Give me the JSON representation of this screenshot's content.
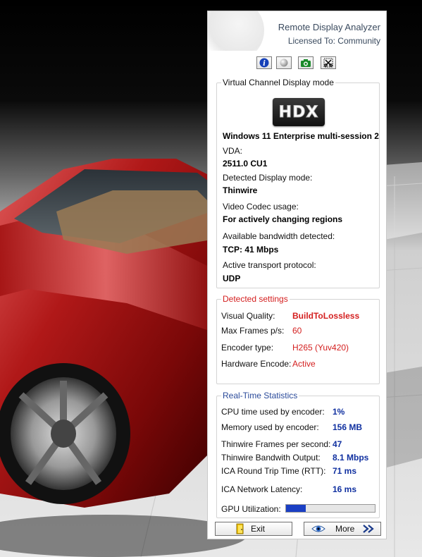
{
  "panel": {
    "title": "Remote Display Analyzer",
    "license": "Licensed To: Community",
    "toolbar": {
      "info_icon": "info-icon",
      "ball_icon": "ball-icon",
      "camera_icon": "camera-icon",
      "snip_icon": "snip-icon"
    },
    "virtual_channel": {
      "group_title": "Virtual Channel Display mode",
      "logo_text": "HDX",
      "os_name": "Windows 11 Enterprise multi-session 2",
      "vda_label": "VDA:",
      "vda_value": "2511.0 CU1",
      "display_mode_label": "Detected Display mode:",
      "display_mode_value": "Thinwire",
      "codec_label": "Video Codec usage:",
      "codec_value": "For actively changing regions",
      "bandwidth_label": "Available bandwidth detected:",
      "bandwidth_value": "TCP: 41 Mbps",
      "transport_label": "Active transport protocol:",
      "transport_value": "UDP"
    },
    "detected": {
      "group_title": "Detected settings",
      "visual_quality_label": "Visual Quality:",
      "visual_quality_value": "BuildToLossless",
      "max_frames_label": "Max Frames p/s:",
      "max_frames_value": "60",
      "encoder_label": "Encoder type:",
      "encoder_value": "H265 (Yuv420)",
      "hw_encode_label": "Hardware Encode:",
      "hw_encode_value": "Active"
    },
    "realtime": {
      "group_title": "Real-Time Statistics",
      "cpu_label": "CPU time used by encoder:",
      "cpu_value": "1%",
      "memory_label": "Memory used by encoder:",
      "memory_value": "156 MB",
      "fps_label": "Thinwire Frames per second:",
      "fps_value": "47",
      "bandwidth_out_label": "Thinwire Bandwith Output:",
      "bandwidth_out_value": "8.1 Mbps",
      "rtt_label": "ICA Round Trip Time (RTT):",
      "rtt_value": "71 ms",
      "latency_label": "ICA Network Latency:",
      "latency_value": "16 ms",
      "gpu_label": "GPU Utilization:",
      "gpu_fraction": 0.22
    },
    "buttons": {
      "exit_label": "Exit",
      "more_label": "More"
    }
  },
  "colors": {
    "accent_red": "#d42020",
    "accent_blue": "#1030a0",
    "gpu_fill": "#1a3fc4"
  }
}
